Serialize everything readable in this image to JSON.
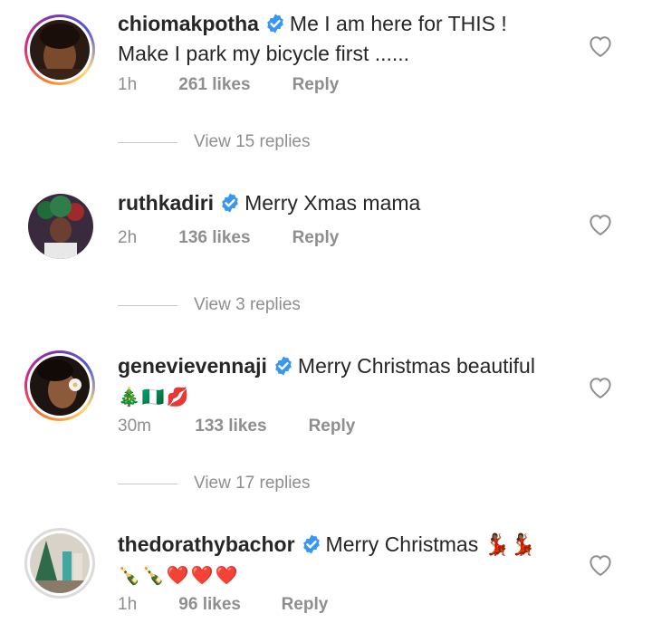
{
  "comments": [
    {
      "username": "chiomakpotha",
      "text_line1": "Me I am here for THIS !",
      "text_line2": "Make I park my bicycle first ......",
      "time": "1h",
      "likes": "261 likes",
      "reply": "Reply",
      "view_replies": "View 15 replies"
    },
    {
      "username": "ruthkadiri",
      "text_line1": "Merry Xmas mama",
      "time": "2h",
      "likes": "136 likes",
      "reply": "Reply",
      "view_replies": "View 3 replies"
    },
    {
      "username": "genevievennaji",
      "text_line1": "Merry Christmas beautiful",
      "text_line2": "🎄🇳🇬💋",
      "time": "30m",
      "likes": "133 likes",
      "reply": "Reply",
      "view_replies": "View 17 replies"
    },
    {
      "username": "thedorathybachor",
      "text_line1": "Merry Christmas 💃🏾💃🏾",
      "text_line2": "🍾🍾❤️❤️❤️",
      "time": "1h",
      "likes": "96 likes",
      "reply": "Reply"
    }
  ],
  "colors": {
    "verified": "#3897f0",
    "muted": "#8e8e8e",
    "text": "#262626"
  },
  "icons": {
    "verified": "verified-badge-icon",
    "like": "heart-outline-icon"
  }
}
